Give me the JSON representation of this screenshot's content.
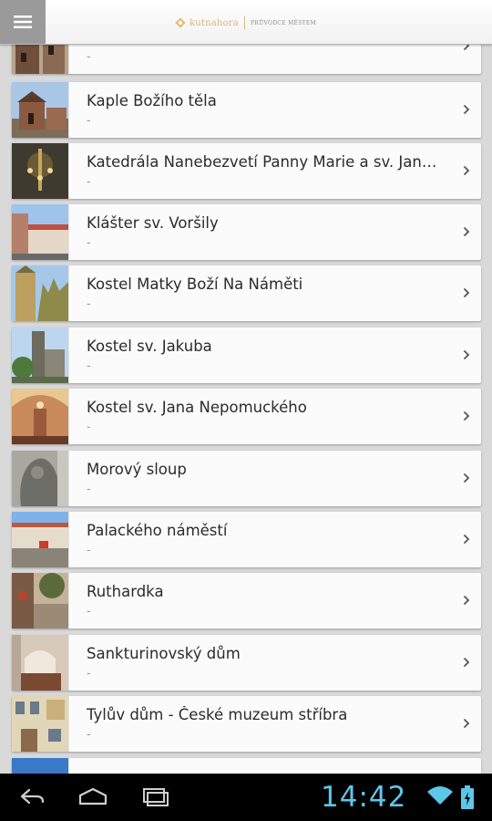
{
  "app_bar": {
    "brand": "kutnahora",
    "tagline": "PRŮVODCE MĚSTEM",
    "menu_icon": "hamburger-icon"
  },
  "items": [
    {
      "title": "",
      "subtitle": "-",
      "thumb": [
        "#6f4e3a",
        "#b9a48b"
      ]
    },
    {
      "title": "Kaple Božího těla",
      "subtitle": "-",
      "thumb": [
        "#8a5a40",
        "#a9c6e6"
      ]
    },
    {
      "title": "Katedrála Nanebezvetí Panny Marie a sv. Jana Křtitele",
      "subtitle": "-",
      "thumb": [
        "#3f3a30",
        "#c9a85c"
      ]
    },
    {
      "title": "Klášter sv. Voršily",
      "subtitle": "-",
      "thumb": [
        "#b5806a",
        "#9fc4ec"
      ]
    },
    {
      "title": "Kostel Matky Boží Na Náměti",
      "subtitle": "-",
      "thumb": [
        "#8d8a4a",
        "#a6c8e8"
      ]
    },
    {
      "title": "Kostel sv. Jakuba",
      "subtitle": "-",
      "thumb": [
        "#6d6a5e",
        "#bcd6f0"
      ]
    },
    {
      "title": "Kostel sv. Jana Nepomuckého",
      "subtitle": "-",
      "thumb": [
        "#9a5a3c",
        "#e8c890"
      ]
    },
    {
      "title": "Morový sloup",
      "subtitle": "-",
      "thumb": [
        "#6e6e68",
        "#a8a8a0"
      ]
    },
    {
      "title": "Palackého náměstí",
      "subtitle": "-",
      "thumb": [
        "#8a8478",
        "#7fb2e8"
      ]
    },
    {
      "title": "Ruthardka",
      "subtitle": "-",
      "thumb": [
        "#7a5a44",
        "#c4b29a"
      ]
    },
    {
      "title": "Sankturinovský dům",
      "subtitle": "-",
      "thumb": [
        "#7a4a32",
        "#d8cab8"
      ]
    },
    {
      "title": "Tylův dům - České muzeum stříbra",
      "subtitle": "-",
      "thumb": [
        "#c9b07a",
        "#e2d6b8"
      ]
    },
    {
      "title": "",
      "subtitle": "",
      "thumb": [
        "#3a78c8",
        "#3a78c8"
      ]
    }
  ],
  "status": {
    "time": "14:42"
  },
  "colors": {
    "accent": "#5ec6e8",
    "brand_gold": "#d7b87a"
  }
}
